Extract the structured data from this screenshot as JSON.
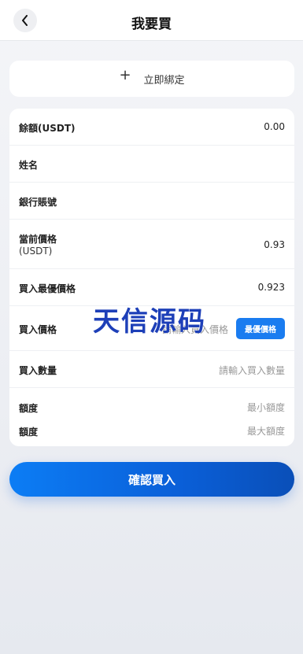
{
  "header": {
    "title": "我要買"
  },
  "bind": {
    "plus": "+",
    "label": "立即綁定"
  },
  "form": {
    "balance": {
      "label": "餘額(USDT)",
      "value": "0.00"
    },
    "name": {
      "label": "姓名"
    },
    "bank": {
      "label": "銀行賬號"
    },
    "current_price": {
      "label": "當前價格",
      "sublabel": "(USDT)",
      "value": "0.93"
    },
    "best_price": {
      "label": "買入最優價格",
      "value": "0.923"
    },
    "buy_price": {
      "label": "買入價格",
      "placeholder": "請輸入買入價格",
      "button": "最優價格"
    },
    "buy_qty": {
      "label": "買入數量",
      "placeholder": "請輸入買入數量"
    },
    "limit_min": {
      "label": "額度",
      "value": "最小額度"
    },
    "limit_max": {
      "label": "額度",
      "value": "最大額度"
    }
  },
  "watermark": "天信源码",
  "confirm": {
    "label": "確認買入"
  },
  "colors": {
    "accent": "#1a7cf0",
    "watermark": "#1d3fb8"
  },
  "icons": {
    "back": "chevron-left-icon"
  }
}
